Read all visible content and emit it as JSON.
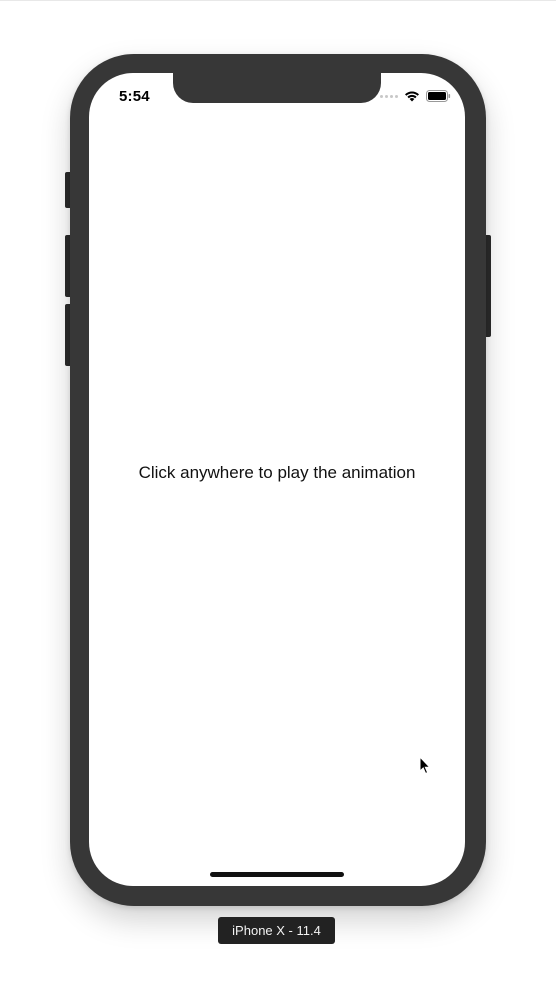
{
  "status_bar": {
    "time": "5:54",
    "signal_icon": "signal-dots-icon",
    "wifi_icon": "wifi-icon",
    "battery_icon": "battery-icon"
  },
  "screen": {
    "message": "Click anywhere to play the animation"
  },
  "device_label": "iPhone X - 11.4",
  "colors": {
    "bezel": "#373737",
    "screen": "#ffffff",
    "text": "#111111",
    "label_bg": "#222222"
  }
}
